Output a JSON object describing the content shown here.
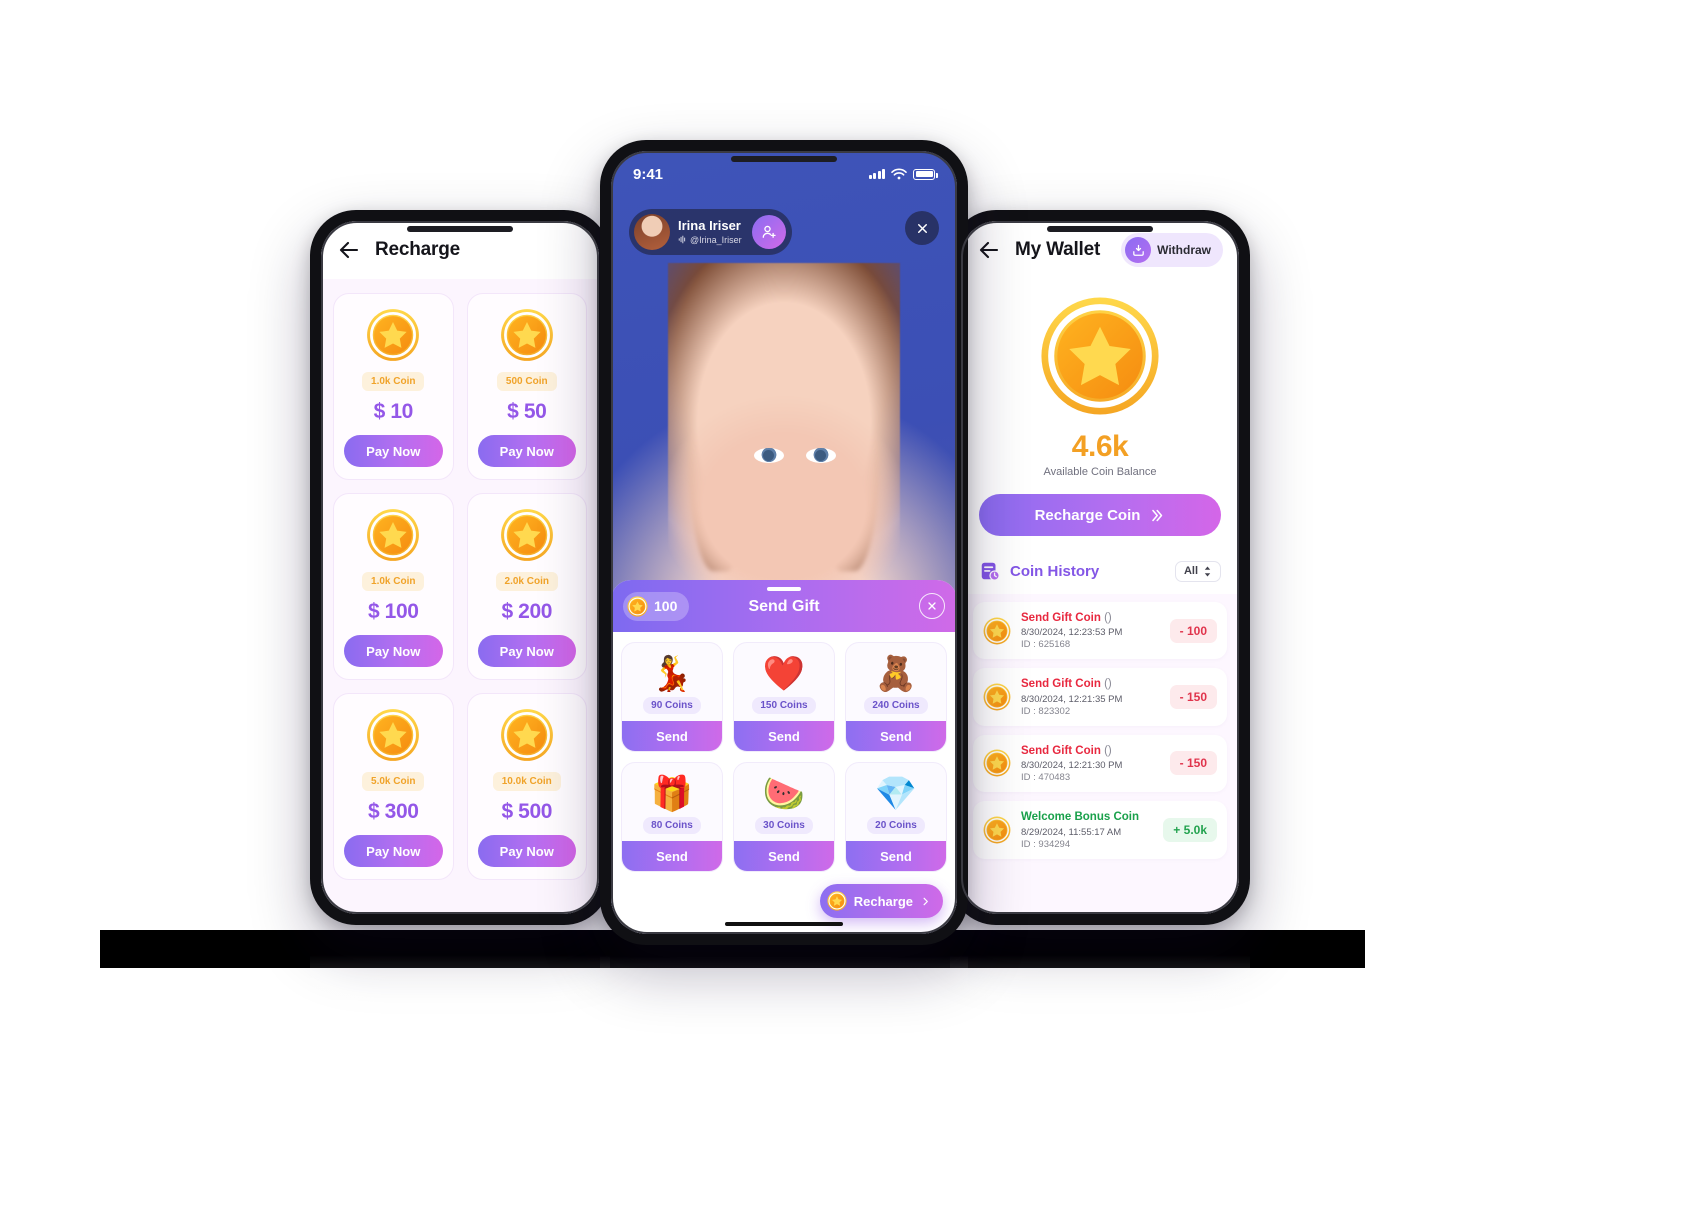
{
  "recharge_screen": {
    "title": "Recharge",
    "back_icon": "arrow-left-icon",
    "packages": [
      {
        "coins": "1.0k Coin",
        "price": "$ 10",
        "cta": "Pay Now"
      },
      {
        "coins": "500 Coin",
        "price": "$ 50",
        "cta": "Pay Now"
      },
      {
        "coins": "1.0k Coin",
        "price": "$ 100",
        "cta": "Pay Now"
      },
      {
        "coins": "2.0k Coin",
        "price": "$ 200",
        "cta": "Pay Now"
      },
      {
        "coins": "5.0k Coin",
        "price": "$ 300",
        "cta": "Pay Now"
      },
      {
        "coins": "10.0k Coin",
        "price": "$ 500",
        "cta": "Pay Now"
      }
    ]
  },
  "live_screen": {
    "status_bar": {
      "time": "9:41",
      "signal_icon": "signal-bars-icon",
      "wifi_icon": "wifi-icon",
      "battery_icon": "battery-full-icon"
    },
    "broadcaster": {
      "name": "Irina Iriser",
      "handle": "@Irina_Iriser",
      "live_icon": "audio-wave-icon",
      "follow_icon": "person-add-icon"
    },
    "close_icon": "close-icon",
    "gift_sheet": {
      "balance": "100",
      "title": "Send Gift",
      "close_icon": "close-circle-icon",
      "gifts": [
        {
          "emoji": "💃",
          "icon_name": "dancing-couple-gift",
          "cost": "90 Coins",
          "cta": "Send"
        },
        {
          "emoji": "❤️",
          "icon_name": "winged-heart-gift",
          "cost": "150 Coins",
          "cta": "Send"
        },
        {
          "emoji": "🧸",
          "icon_name": "teddy-bear-gift",
          "cost": "240 Coins",
          "cta": "Send"
        },
        {
          "emoji": "🎁",
          "icon_name": "gift-box-gift",
          "cost": "80 Coins",
          "cta": "Send"
        },
        {
          "emoji": "🍉",
          "icon_name": "watermelon-pop-gift",
          "cost": "30 Coins",
          "cta": "Send"
        },
        {
          "emoji": "💎",
          "icon_name": "gem-heart-gift",
          "cost": "20 Coins",
          "cta": "Send"
        }
      ],
      "recharge_label": "Recharge",
      "recharge_chevron": "chevron-right-icon"
    }
  },
  "wallet_screen": {
    "title": "My Wallet",
    "back_icon": "arrow-left-icon",
    "withdraw": {
      "label": "Withdraw",
      "icon": "withdraw-tray-icon"
    },
    "balance": {
      "amount": "4.6k",
      "label": "Available Coin Balance",
      "coin_icon": "star-coin-icon"
    },
    "recharge_button": {
      "label": "Recharge Coin",
      "chevron": "double-chevron-right-icon"
    },
    "history": {
      "title": "Coin History",
      "icon": "history-book-icon",
      "filter": {
        "value": "All",
        "icon": "chevron-updown-icon"
      },
      "rows": [
        {
          "name": "Send Gift Coin",
          "paren": "()",
          "date": "8/30/2024, 12:23:53 PM",
          "id": "ID : 625168",
          "amount": "- 100",
          "type": "negative"
        },
        {
          "name": "Send Gift Coin",
          "paren": "()",
          "date": "8/30/2024, 12:21:35 PM",
          "id": "ID : 823302",
          "amount": "- 150",
          "type": "negative"
        },
        {
          "name": "Send Gift Coin",
          "paren": "()",
          "date": "8/30/2024, 12:21:30 PM",
          "id": "ID : 470483",
          "amount": "- 150",
          "type": "negative"
        },
        {
          "name": "Welcome Bonus Coin",
          "paren": "",
          "date": "8/29/2024, 11:55:17 AM",
          "id": "ID : 934294",
          "amount": "+ 5.0k",
          "type": "positive"
        }
      ]
    }
  },
  "theme": {
    "purple": "#8a6cf0",
    "magenta": "#d466e8",
    "gold": "#f3a024",
    "red": "#e8283f",
    "green": "#1aa14b"
  }
}
